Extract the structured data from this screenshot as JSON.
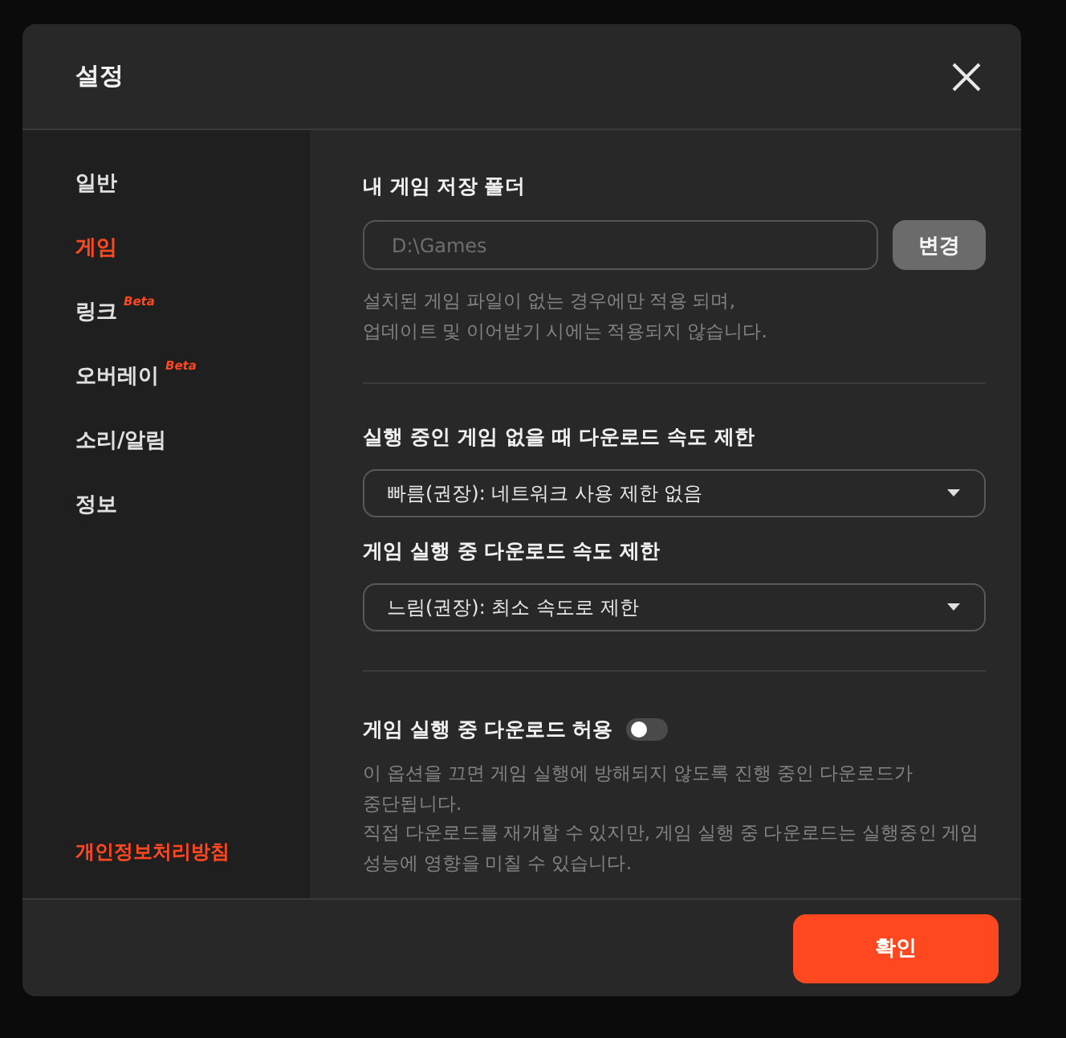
{
  "dialog": {
    "title": "설정"
  },
  "sidebar": {
    "items": [
      {
        "label": "일반",
        "selected": false
      },
      {
        "label": "게임",
        "selected": true
      },
      {
        "label": "링크",
        "badge": "Beta",
        "selected": false
      },
      {
        "label": "오버레이",
        "badge": "Beta",
        "selected": false
      },
      {
        "label": "소리/알림",
        "selected": false
      },
      {
        "label": "정보",
        "selected": false
      }
    ],
    "footer_link": "개인정보처리방침"
  },
  "folder": {
    "heading": "내 게임 저장 폴더",
    "value": "D:\\Games",
    "button": "변경",
    "hint": "설치된 게임 파일이 없는 경우에만 적용 되며,\n업데이트 및 이어받기 시에는 적용되지 않습니다."
  },
  "speed_limits": [
    {
      "heading": "실행 중인 게임 없을 때 다운로드 속도 제한",
      "value": "빠름(권장): 네트워크 사용 제한 없음"
    },
    {
      "heading": "게임 실행 중 다운로드 속도 제한",
      "value": "느림(권장): 최소 속도로 제한"
    }
  ],
  "allow_download": {
    "label": "게임 실행 중 다운로드 허용",
    "on": false,
    "hint": "이 옵션을 끄면 게임 실행에 방해되지 않도록 진행 중인 다운로드가\n중단됩니다.\n직접 다운로드를 재개할 수 있지만, 게임 실행 중 다운로드는 실행중인 게임\n성능에 영향을 미칠 수 있습니다."
  },
  "footer": {
    "confirm": "확인"
  }
}
